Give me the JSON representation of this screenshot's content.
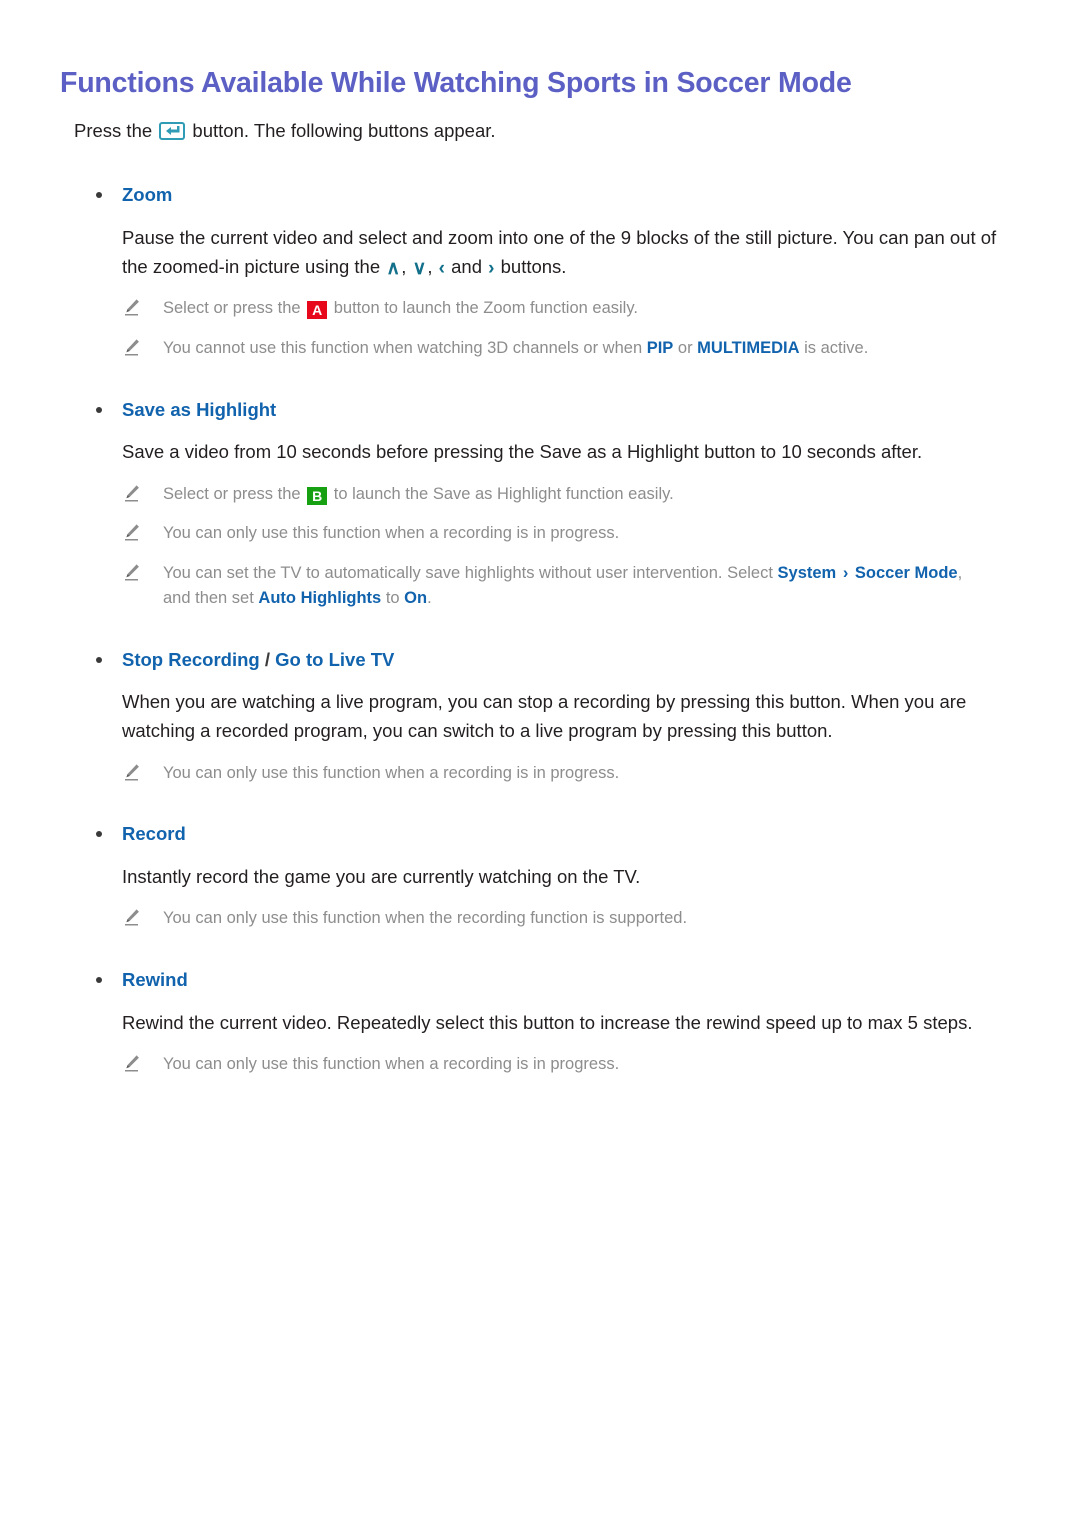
{
  "page": {
    "title": "Functions Available While Watching Sports in Soccer Mode",
    "title_color": "#5c60c4",
    "accent_link_color": "#1263ad",
    "note_text_color": "#8d8d8d",
    "chevron_color": "#13708b",
    "key_a_color": "#e8081b",
    "key_b_color": "#18a013"
  },
  "intro": {
    "before_icon": "Press the ",
    "icon": "enter-button-icon",
    "after_icon": " button. The following buttons appear."
  },
  "sections": [
    {
      "id": "zoom",
      "heading": "Zoom",
      "body_part_1": "Pause the current video and select and zoom into one of the 9 blocks of the still picture. You can pan out of the zoomed-in picture using the ",
      "chevrons": [
        "∧",
        "∨",
        "‹",
        "›"
      ],
      "chevron_sep_1": ", ",
      "chevron_sep_2": ", ",
      "chevron_sep_3": " and ",
      "body_part_2": " buttons.",
      "notes": [
        {
          "icon": "pencil-icon",
          "segments": [
            {
              "text": "Select or press the ",
              "style": "plain"
            },
            {
              "text": "A",
              "style": "key-a"
            },
            {
              "text": " button to launch the Zoom function easily.",
              "style": "plain"
            }
          ]
        },
        {
          "icon": "pencil-icon",
          "segments": [
            {
              "text": "You cannot use this function when watching 3D channels or when ",
              "style": "plain"
            },
            {
              "text": "PIP",
              "style": "highlight"
            },
            {
              "text": " or ",
              "style": "plain"
            },
            {
              "text": "MULTIMEDIA",
              "style": "highlight"
            },
            {
              "text": " is active.",
              "style": "plain"
            }
          ]
        }
      ]
    },
    {
      "id": "save-as-highlight",
      "heading": "Save as Highlight",
      "body": "Save a video from 10 seconds before pressing the Save as a Highlight button to 10 seconds after.",
      "notes": [
        {
          "icon": "pencil-icon",
          "segments": [
            {
              "text": "Select or press the ",
              "style": "plain"
            },
            {
              "text": "B",
              "style": "key-b"
            },
            {
              "text": " to launch the Save as Highlight function easily.",
              "style": "plain"
            }
          ]
        },
        {
          "icon": "pencil-icon",
          "segments": [
            {
              "text": "You can only use this function when a recording is in progress.",
              "style": "plain"
            }
          ]
        },
        {
          "icon": "pencil-icon",
          "segments": [
            {
              "text": "You can set the TV to automatically save highlights without user intervention. Select ",
              "style": "plain"
            },
            {
              "text": "System",
              "style": "highlight"
            },
            {
              "text": " › ",
              "style": "arrow"
            },
            {
              "text": "Soccer Mode",
              "style": "highlight"
            },
            {
              "text": ", and then set ",
              "style": "plain"
            },
            {
              "text": "Auto Highlights",
              "style": "highlight"
            },
            {
              "text": " to ",
              "style": "plain"
            },
            {
              "text": "On",
              "style": "highlight"
            },
            {
              "text": ".",
              "style": "plain"
            }
          ]
        }
      ]
    },
    {
      "id": "stop-recording",
      "heading_part_1": "Stop Recording",
      "heading_separator": " / ",
      "heading_part_2": "Go to Live TV",
      "body": "When you are watching a live program, you can stop a recording by pressing this button. When you are watching a recorded program, you can switch to a live program by pressing this button.",
      "notes": [
        {
          "icon": "pencil-icon",
          "segments": [
            {
              "text": "You can only use this function when a recording is in progress.",
              "style": "plain"
            }
          ]
        }
      ]
    },
    {
      "id": "record",
      "heading": "Record",
      "body": "Instantly record the game you are currently watching on the TV.",
      "notes": [
        {
          "icon": "pencil-icon",
          "segments": [
            {
              "text": "You can only use this function when the recording function is supported.",
              "style": "plain"
            }
          ]
        }
      ]
    },
    {
      "id": "rewind",
      "heading": "Rewind",
      "body": "Rewind the current video. Repeatedly select this button to increase the rewind speed up to max 5 steps.",
      "notes": [
        {
          "icon": "pencil-icon",
          "segments": [
            {
              "text": "You can only use this function when a recording is in progress.",
              "style": "plain"
            }
          ]
        }
      ]
    }
  ]
}
